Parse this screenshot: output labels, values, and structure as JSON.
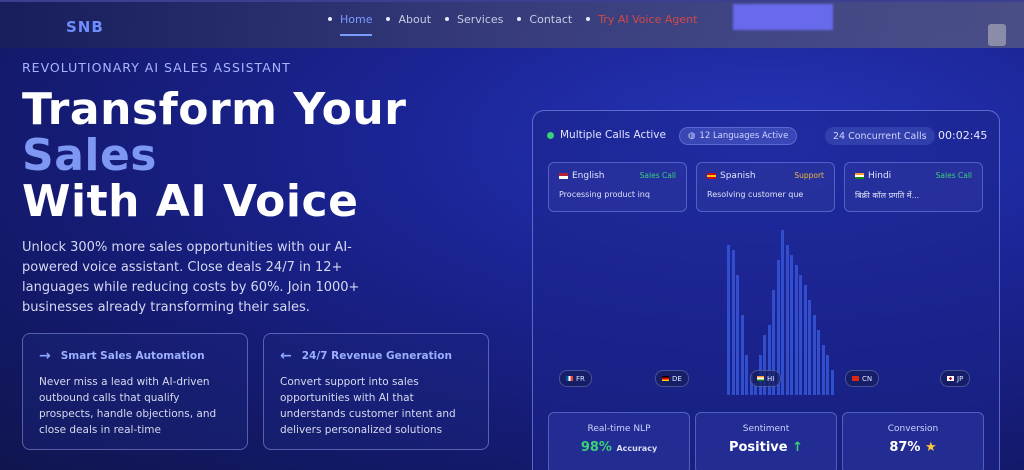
{
  "brand": {
    "logo": "SNB"
  },
  "nav": {
    "items": [
      {
        "label": "Home",
        "active": true
      },
      {
        "label": "About"
      },
      {
        "label": "Services"
      },
      {
        "label": "Contact"
      },
      {
        "label": "Try AI Voice Agent",
        "cta": true
      }
    ]
  },
  "hero": {
    "tagline": "REVOLUTIONARY AI SALES ASSISTANT",
    "title_line1": "Transform Your",
    "title_line2": "Sales",
    "title_line3": "With AI Voice",
    "description": "Unlock 300% more sales opportunities with our AI-powered voice assistant. Close deals 24/7 in 12+ languages while reducing costs by 60%. Join 1000+ businesses already transforming their sales."
  },
  "features": [
    {
      "icon": "arrow-right-icon",
      "title": "Smart Sales Automation",
      "text": "Never miss a lead with AI-driven outbound calls that qualify prospects, handle objections, and close deals in real-time"
    },
    {
      "icon": "arrow-left-icon",
      "title": "24/7 Revenue Generation",
      "text": "Convert support into sales opportunities with AI that understands customer intent and delivers personalized solutions"
    }
  ],
  "dashboard": {
    "status": "Multiple Calls Active",
    "languages_pill": "12 Languages Active",
    "concurrent_pill": "24 Concurrent Calls",
    "timer": "00:02:45",
    "calls": [
      {
        "lang": "English",
        "tag": "Sales Call",
        "tag_color": "#3ad07a",
        "text": "Processing product inq"
      },
      {
        "lang": "Spanish",
        "tag": "Support",
        "tag_color": "#f2b83a",
        "text": "Resolving customer que"
      },
      {
        "lang": "Hindi",
        "tag": "Sales Call",
        "tag_color": "#3ad07a",
        "text": "बिक्री कॉल प्रगति में..."
      }
    ],
    "chips": [
      "FR",
      "DE",
      "HI",
      "CN",
      "JP"
    ],
    "metrics": [
      {
        "title": "Real-time NLP",
        "value": "98%",
        "sub": "Accuracy",
        "value_color": "#3ad07a"
      },
      {
        "title": "Sentiment",
        "value": "Positive",
        "sub": "↑",
        "value_color": "#ffffff"
      },
      {
        "title": "Conversion",
        "value": "87%",
        "sub": "★",
        "value_color": "#ffffff"
      }
    ]
  },
  "colors": {
    "accent": "#7d97f2",
    "green": "#3ad07a",
    "cta": "#d14848"
  }
}
